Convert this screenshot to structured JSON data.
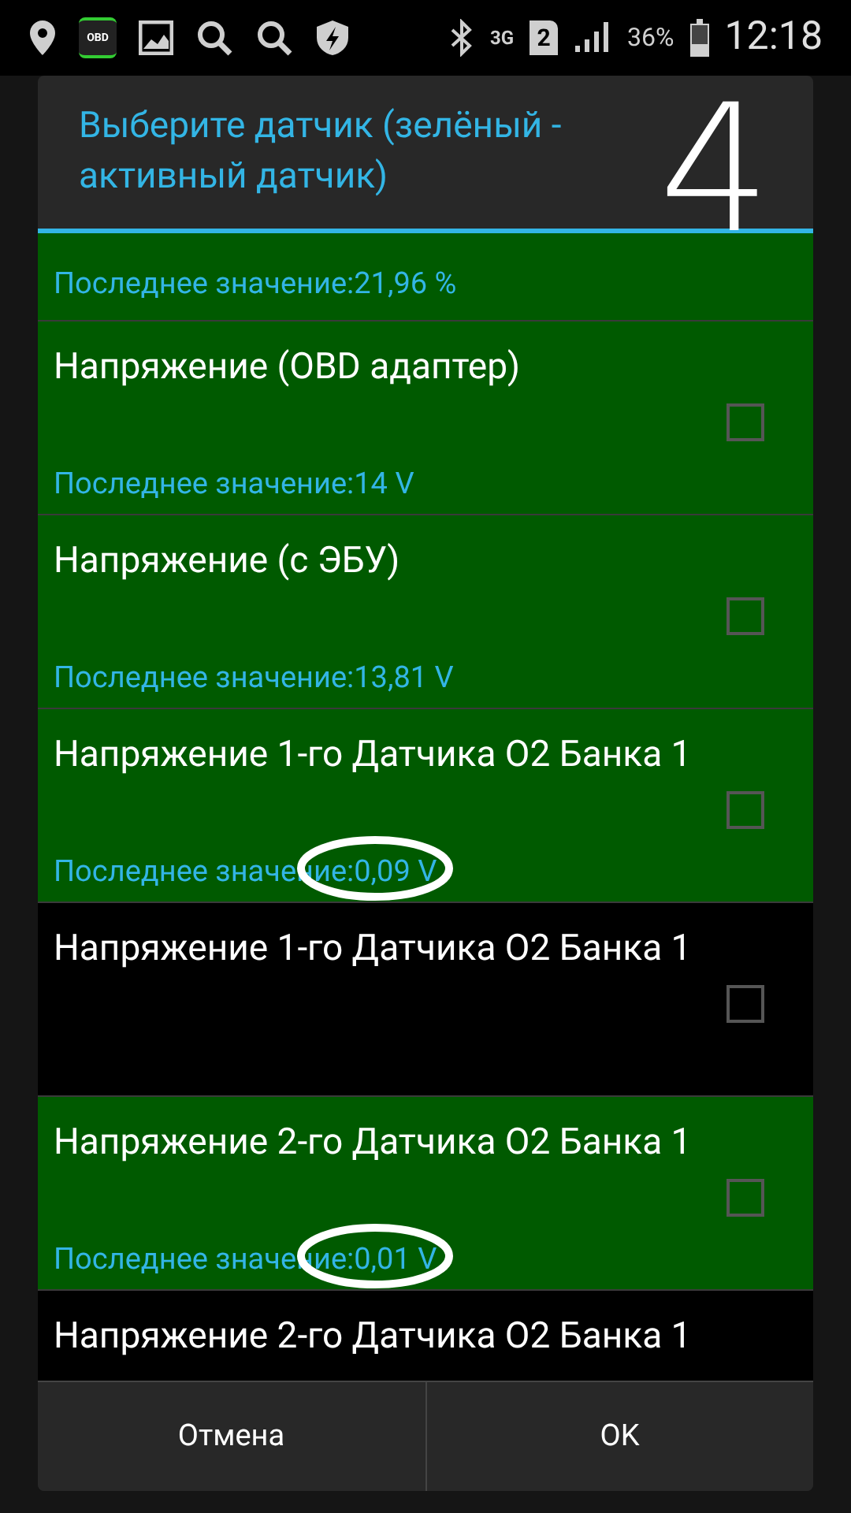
{
  "status_bar": {
    "obd_label": "OBD",
    "network": "3G",
    "sim": "2",
    "battery": "36%",
    "time": "12:18"
  },
  "dialog": {
    "title": "Выберите датчик (зелёный - активный датчик)",
    "items": [
      {
        "value": "Последнее значение:21,96 %",
        "active": true,
        "circled": false
      },
      {
        "title": "Напряжение (OBD адаптер)",
        "value": "Последнее значение:14 V",
        "active": true,
        "checked": false,
        "circled": false
      },
      {
        "title": "Напряжение (с ЭБУ)",
        "value": "Последнее значение:13,81 V",
        "active": true,
        "checked": false,
        "circled": false
      },
      {
        "title": "Напряжение 1-го Датчика O2 Банка 1",
        "value": "Последнее значение:0,09 V",
        "active": true,
        "checked": false,
        "circled": true
      },
      {
        "title": "Напряжение 1-го Датчика O2 Банка 1",
        "active": false,
        "checked": false
      },
      {
        "title": "Напряжение 2-го Датчика O2 Банка 1",
        "value": "Последнее значение:0,01 V",
        "active": true,
        "checked": false,
        "circled": true
      },
      {
        "title": "Напряжение 2-го Датчика O2 Банка 1",
        "active": false
      }
    ],
    "buttons": [
      "Отмена",
      "OK"
    ]
  },
  "annotation": "4"
}
